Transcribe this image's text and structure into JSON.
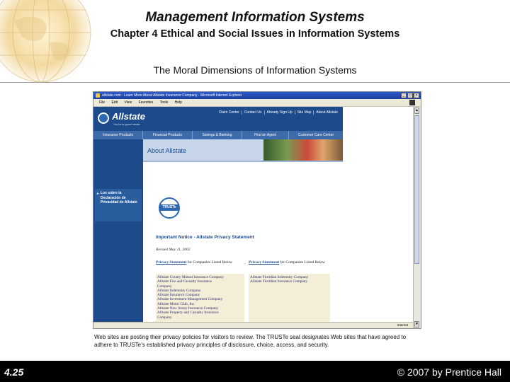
{
  "slide": {
    "title": "Management Information Systems",
    "subtitle": "Chapter 4 Ethical and Social Issues in Information Systems",
    "section": "The Moral Dimensions of Information Systems",
    "caption": "Web sites are posting their privacy policies for visitors to review. The TRUSTe seal designates Web sites that have agreed to adhere to TRUSTe’s established privacy principles of disclosure, choice, access, and security.",
    "slide_number": "4.25",
    "copyright": "© 2007 by Prentice Hall"
  },
  "browser": {
    "window_title": "allstate.com - Learn More About Allstate Insurance Company - Microsoft Internet Explorer",
    "menu": [
      "File",
      "Edit",
      "View",
      "Favorites",
      "Tools",
      "Help"
    ],
    "status_zone": "Internet"
  },
  "site": {
    "brand": "Allstate",
    "tagline": "You're in good hands.",
    "top_links": [
      "Claim Center",
      "Contact Us",
      "Already Sign Up",
      "Site Map",
      "About Allstate"
    ],
    "nav": [
      "Insurance Products",
      "Financial Products",
      "Savings & Banking",
      "Find an Agent",
      "Customer Care Center"
    ],
    "banner_title": "About Allstate",
    "left_box": "Los sobre la Declaración de Privacidad de Allstate",
    "truste_label": "TRUSTe",
    "notice_title": "Important Notice - Allstate Privacy Statement",
    "revised": "Revised May 11, 2002",
    "col1_link": "Privacy Statement",
    "col1_rest": "for Companies Listed Below",
    "col2_link": "Privacy Statement",
    "col2_rest": "for Companies Listed Below",
    "col1_companies": [
      "Allstate County Mutual Insurance Company",
      "Allstate Fire and Casualty Insurance",
      "  Company",
      "Allstate Indemnity Company",
      "Allstate Insurance Company",
      "Allstate Investment Management Company",
      "Allstate Motor Club, Inc.",
      "Allstate New Jersey Insurance Company",
      "Allstate Property and Casualty Insurance",
      "  Company"
    ],
    "col2_companies": [
      "Allstate Floridian Indemnity Company",
      "Allstate Floridian Insurance Company"
    ]
  }
}
